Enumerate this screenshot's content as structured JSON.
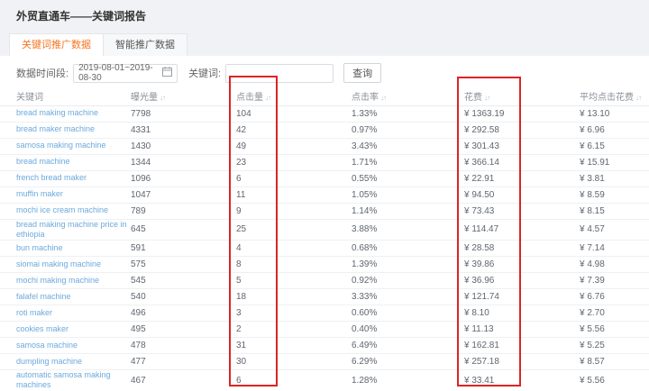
{
  "page": {
    "title": "外贸直通车——关键词报告"
  },
  "tabs": [
    {
      "label": "关键词推广数据",
      "active": true
    },
    {
      "label": "智能推广数据",
      "active": false
    }
  ],
  "filters": {
    "date_label": "数据时间段:",
    "date_value": "2019-08-01~2019-08-30",
    "keyword_label": "关键词:",
    "keyword_value": "",
    "search_button": "查询"
  },
  "table": {
    "sort_icon": "↓↑",
    "columns": [
      {
        "label": "关键词"
      },
      {
        "label": "曝光量"
      },
      {
        "label": "点击量"
      },
      {
        "label": "点击率"
      },
      {
        "label": "花费"
      },
      {
        "label": "平均点击花费"
      }
    ],
    "rows": [
      {
        "keyword": "bread making machine",
        "exposure": "7798",
        "clicks": "104",
        "ctr": "1.33%",
        "cost": "¥ 1363.19",
        "avg_cost": "¥ 13.10"
      },
      {
        "keyword": "bread maker machine",
        "exposure": "4331",
        "clicks": "42",
        "ctr": "0.97%",
        "cost": "¥ 292.58",
        "avg_cost": "¥ 6.96"
      },
      {
        "keyword": "samosa making machine",
        "exposure": "1430",
        "clicks": "49",
        "ctr": "3.43%",
        "cost": "¥ 301.43",
        "avg_cost": "¥ 6.15"
      },
      {
        "keyword": "bread machine",
        "exposure": "1344",
        "clicks": "23",
        "ctr": "1.71%",
        "cost": "¥ 366.14",
        "avg_cost": "¥ 15.91"
      },
      {
        "keyword": "french bread maker",
        "exposure": "1096",
        "clicks": "6",
        "ctr": "0.55%",
        "cost": "¥ 22.91",
        "avg_cost": "¥ 3.81"
      },
      {
        "keyword": "muffin maker",
        "exposure": "1047",
        "clicks": "11",
        "ctr": "1.05%",
        "cost": "¥ 94.50",
        "avg_cost": "¥ 8.59"
      },
      {
        "keyword": "mochi ice cream machine",
        "exposure": "789",
        "clicks": "9",
        "ctr": "1.14%",
        "cost": "¥ 73.43",
        "avg_cost": "¥ 8.15"
      },
      {
        "keyword": "bread making machine price in ethiopia",
        "exposure": "645",
        "clicks": "25",
        "ctr": "3.88%",
        "cost": "¥ 114.47",
        "avg_cost": "¥ 4.57"
      },
      {
        "keyword": "bun machine",
        "exposure": "591",
        "clicks": "4",
        "ctr": "0.68%",
        "cost": "¥ 28.58",
        "avg_cost": "¥ 7.14"
      },
      {
        "keyword": "siomai making machine",
        "exposure": "575",
        "clicks": "8",
        "ctr": "1.39%",
        "cost": "¥ 39.86",
        "avg_cost": "¥ 4.98"
      },
      {
        "keyword": "mochi making machine",
        "exposure": "545",
        "clicks": "5",
        "ctr": "0.92%",
        "cost": "¥ 36.96",
        "avg_cost": "¥ 7.39"
      },
      {
        "keyword": "falafel machine",
        "exposure": "540",
        "clicks": "18",
        "ctr": "3.33%",
        "cost": "¥ 121.74",
        "avg_cost": "¥ 6.76"
      },
      {
        "keyword": "roti maker",
        "exposure": "496",
        "clicks": "3",
        "ctr": "0.60%",
        "cost": "¥ 8.10",
        "avg_cost": "¥ 2.70"
      },
      {
        "keyword": "cookies maker",
        "exposure": "495",
        "clicks": "2",
        "ctr": "0.40%",
        "cost": "¥ 11.13",
        "avg_cost": "¥ 5.56"
      },
      {
        "keyword": "samosa machine",
        "exposure": "478",
        "clicks": "31",
        "ctr": "6.49%",
        "cost": "¥ 162.81",
        "avg_cost": "¥ 5.25"
      },
      {
        "keyword": "dumpling machine",
        "exposure": "477",
        "clicks": "30",
        "ctr": "6.29%",
        "cost": "¥ 257.18",
        "avg_cost": "¥ 8.57"
      },
      {
        "keyword": "automatic samosa making machines",
        "exposure": "467",
        "clicks": "6",
        "ctr": "1.28%",
        "cost": "¥ 33.41",
        "avg_cost": "¥ 5.56"
      }
    ]
  },
  "annotations": {
    "clicks_column_highlight": "red box around 点击量 column",
    "cost_column_highlight": "red box around 花费 column"
  },
  "colors": {
    "accent_orange": "#f57523",
    "link_blue": "#6ca9dc",
    "highlight_red": "#dd2424",
    "page_background": "#f1f2f5"
  }
}
